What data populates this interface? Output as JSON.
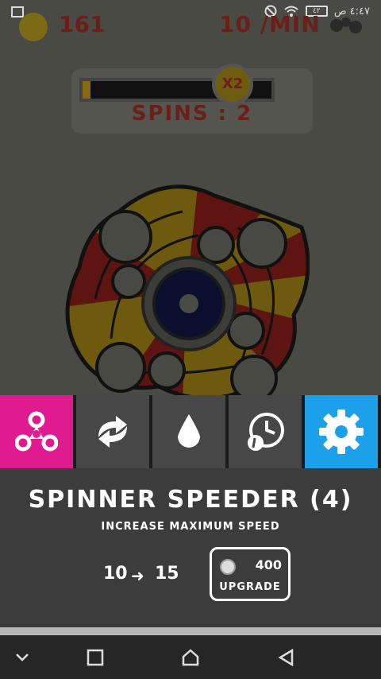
{
  "status": {
    "time": "٤:٤٧ ص",
    "battery": "٤٢"
  },
  "hud": {
    "coins": "161",
    "rate": "10 /MIN"
  },
  "progress": {
    "fill_fraction": 0.04,
    "multiplier": "X2",
    "spins_label": "SPINS : 2"
  },
  "toolbar": {
    "items": [
      {
        "icon": "fidget-spinner-icon",
        "active": true
      },
      {
        "icon": "refresh-icon",
        "active": false
      },
      {
        "icon": "drop-icon",
        "active": false
      },
      {
        "icon": "timer-icon",
        "active": false
      },
      {
        "icon": "gear-icon",
        "active": true
      }
    ]
  },
  "upgrade": {
    "title": "SPINNER SPEEDER (4)",
    "description": "INCREASE MAXIMUM SPEED",
    "from_value": "10",
    "to_value": "15",
    "cost": "400",
    "button_label": "UPGRADE"
  },
  "colors": {
    "pink_accent": "#e01b8f",
    "blue_accent": "#1da0ea",
    "dim_red_text": "#6b1f18"
  }
}
